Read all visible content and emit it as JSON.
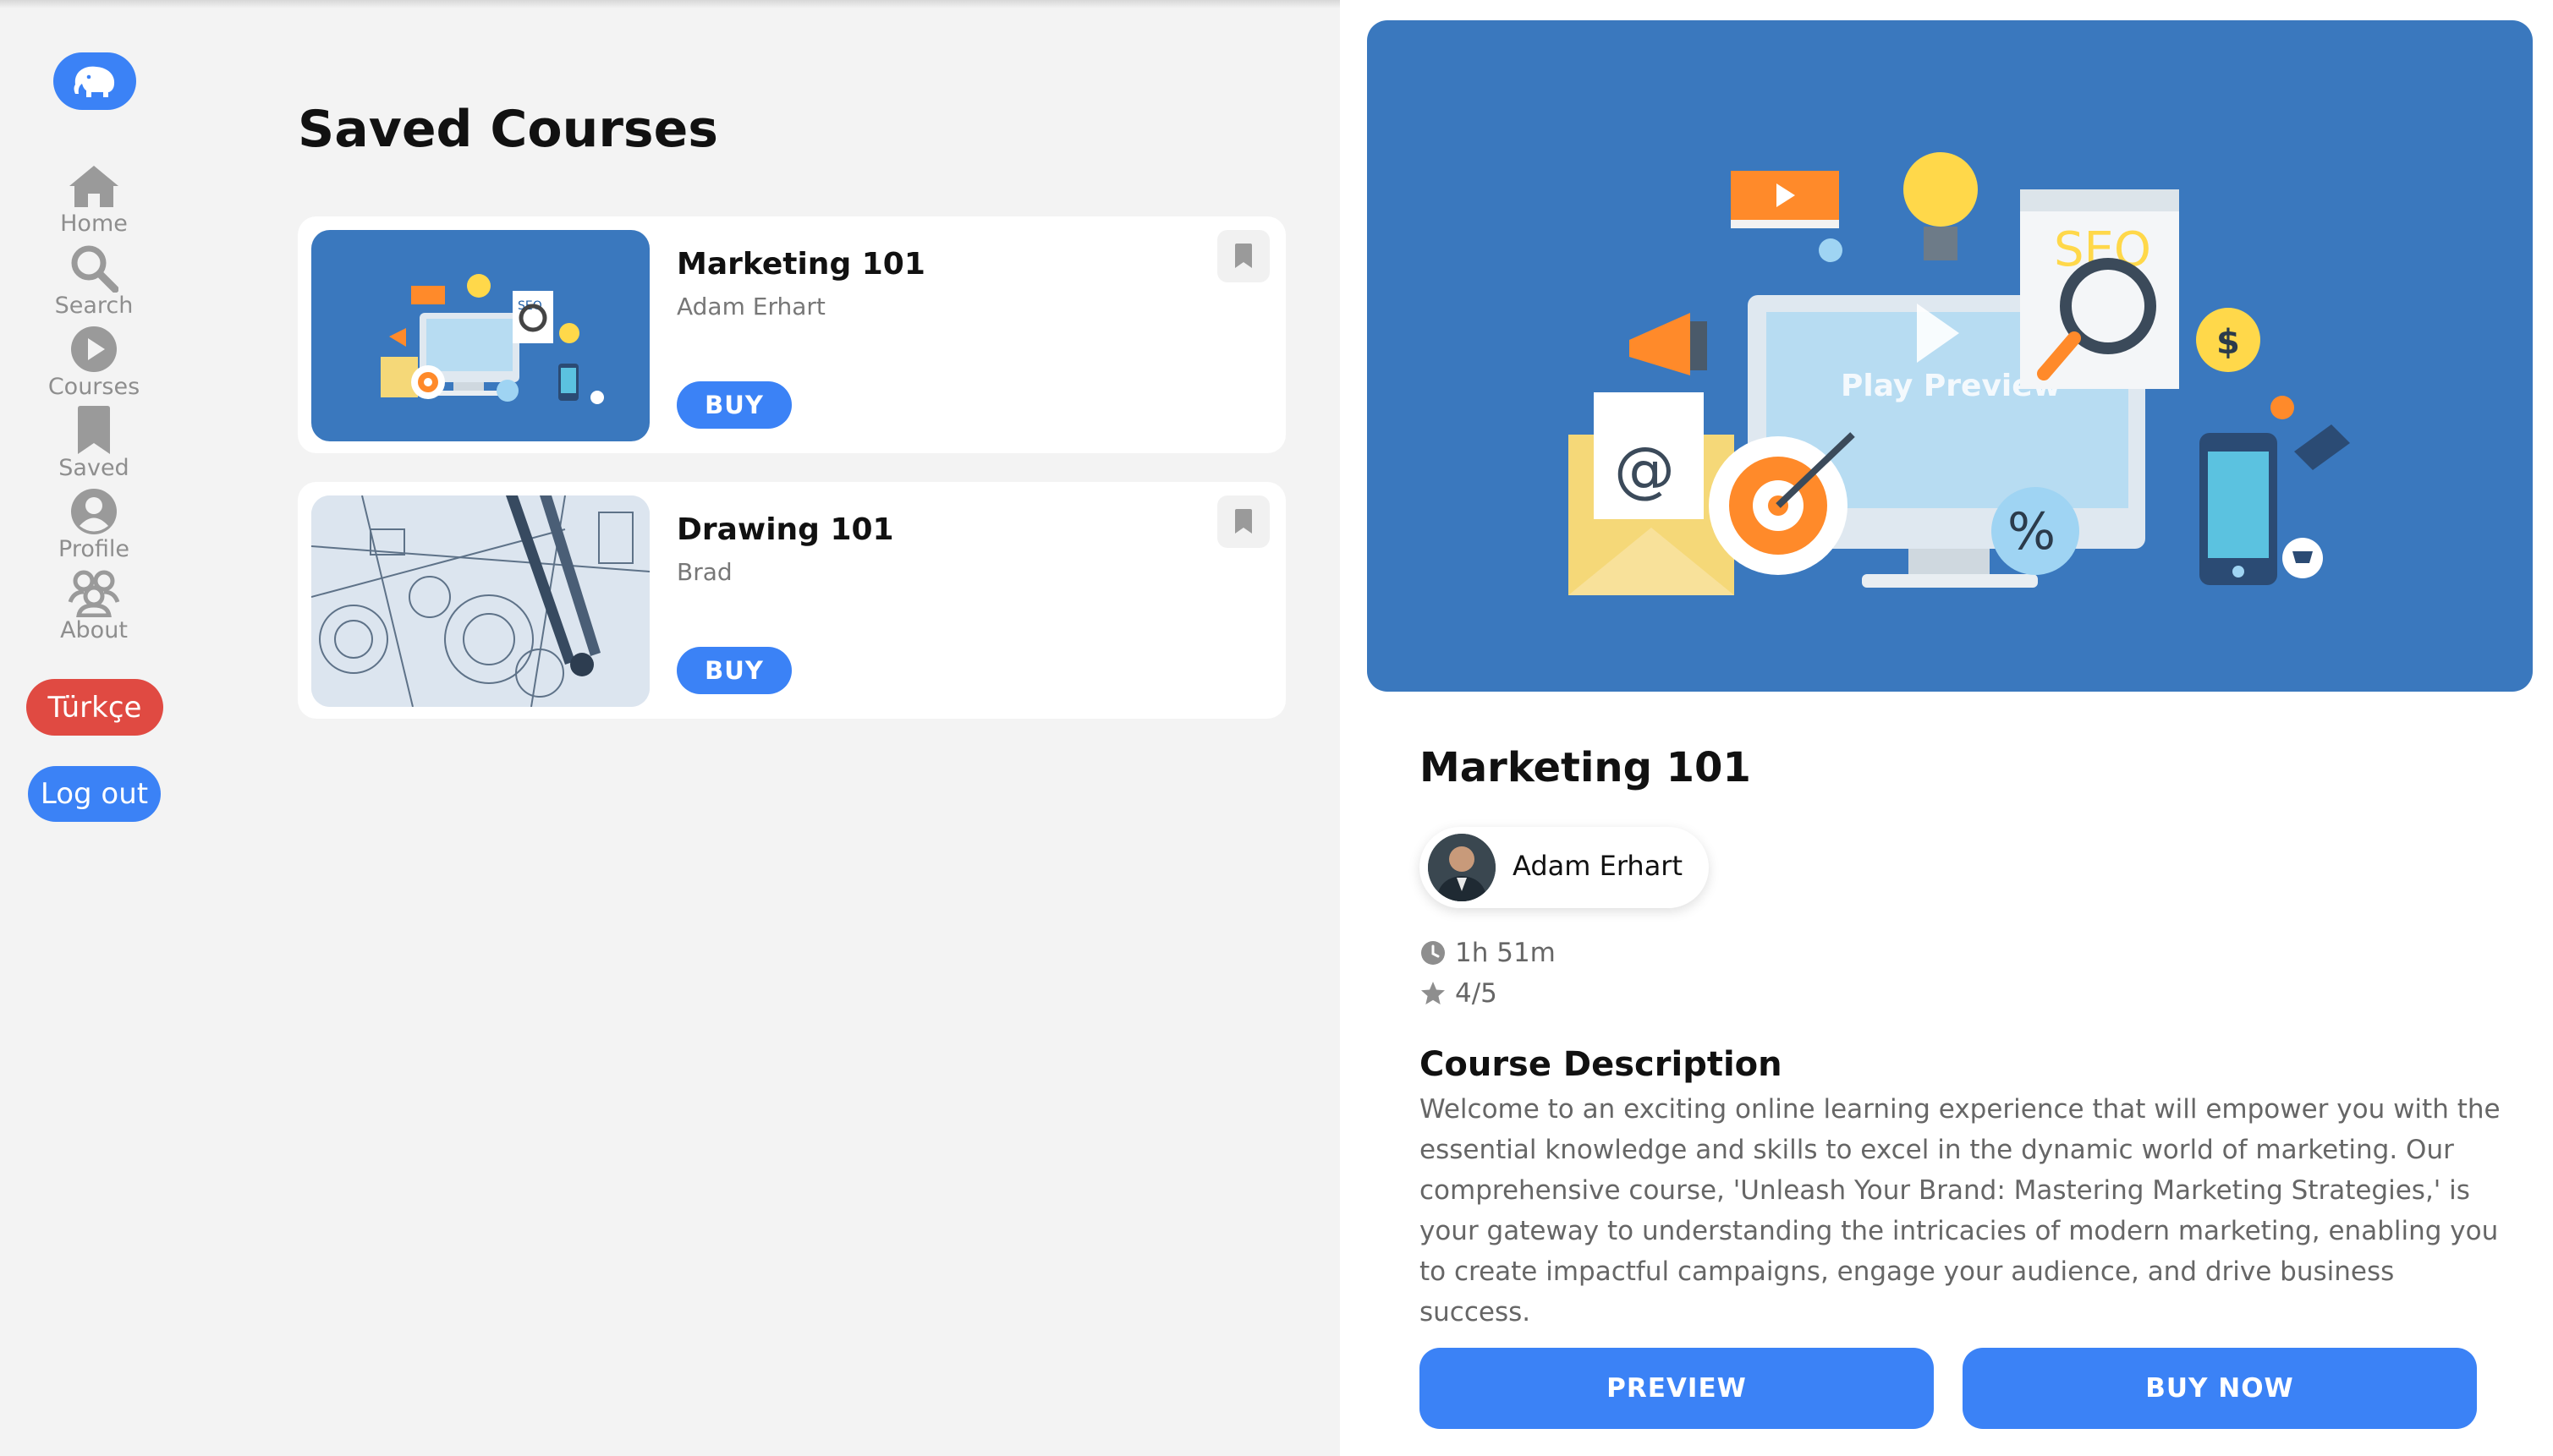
{
  "sidebar": {
    "logo_icon": "elephant-icon",
    "items": [
      {
        "label": "Home",
        "icon": "home-icon"
      },
      {
        "label": "Search",
        "icon": "search-icon"
      },
      {
        "label": "Courses",
        "icon": "play-circle-icon"
      },
      {
        "label": "Saved",
        "icon": "bookmark-icon"
      },
      {
        "label": "Profile",
        "icon": "user-icon"
      },
      {
        "label": "About",
        "icon": "users-icon"
      }
    ],
    "language_button": "Türkçe",
    "logout_button": "Log out"
  },
  "saved": {
    "title": "Saved Courses",
    "courses": [
      {
        "title": "Marketing 101",
        "author": "Adam Erhart",
        "buy_label": "BUY",
        "bookmark_icon": "bookmark-icon"
      },
      {
        "title": "Drawing 101",
        "author": "Brad",
        "buy_label": "BUY",
        "bookmark_icon": "bookmark-icon"
      }
    ]
  },
  "detail": {
    "hero_caption": "Play Preview",
    "title": "Marketing 101",
    "author": "Adam Erhart",
    "duration": "1h 51m",
    "rating": "4/5",
    "description_heading": "Course Description",
    "description": "Welcome to an exciting online learning experience that will empower you with the essential knowledge and skills to excel in the dynamic world of marketing. Our comprehensive course, 'Unleash Your Brand: Mastering Marketing Strategies,' is your gateway to understanding the intricacies of modern marketing, enabling you to create impactful campaigns, engage your audience, and drive business success.",
    "preview_button": "PREVIEW",
    "buy_now_button": "BUY NOW"
  },
  "colors": {
    "accent": "#3b82f6",
    "danger": "#e04a42",
    "hero_bg": "#3a78be",
    "background": "#f3f3f3"
  }
}
